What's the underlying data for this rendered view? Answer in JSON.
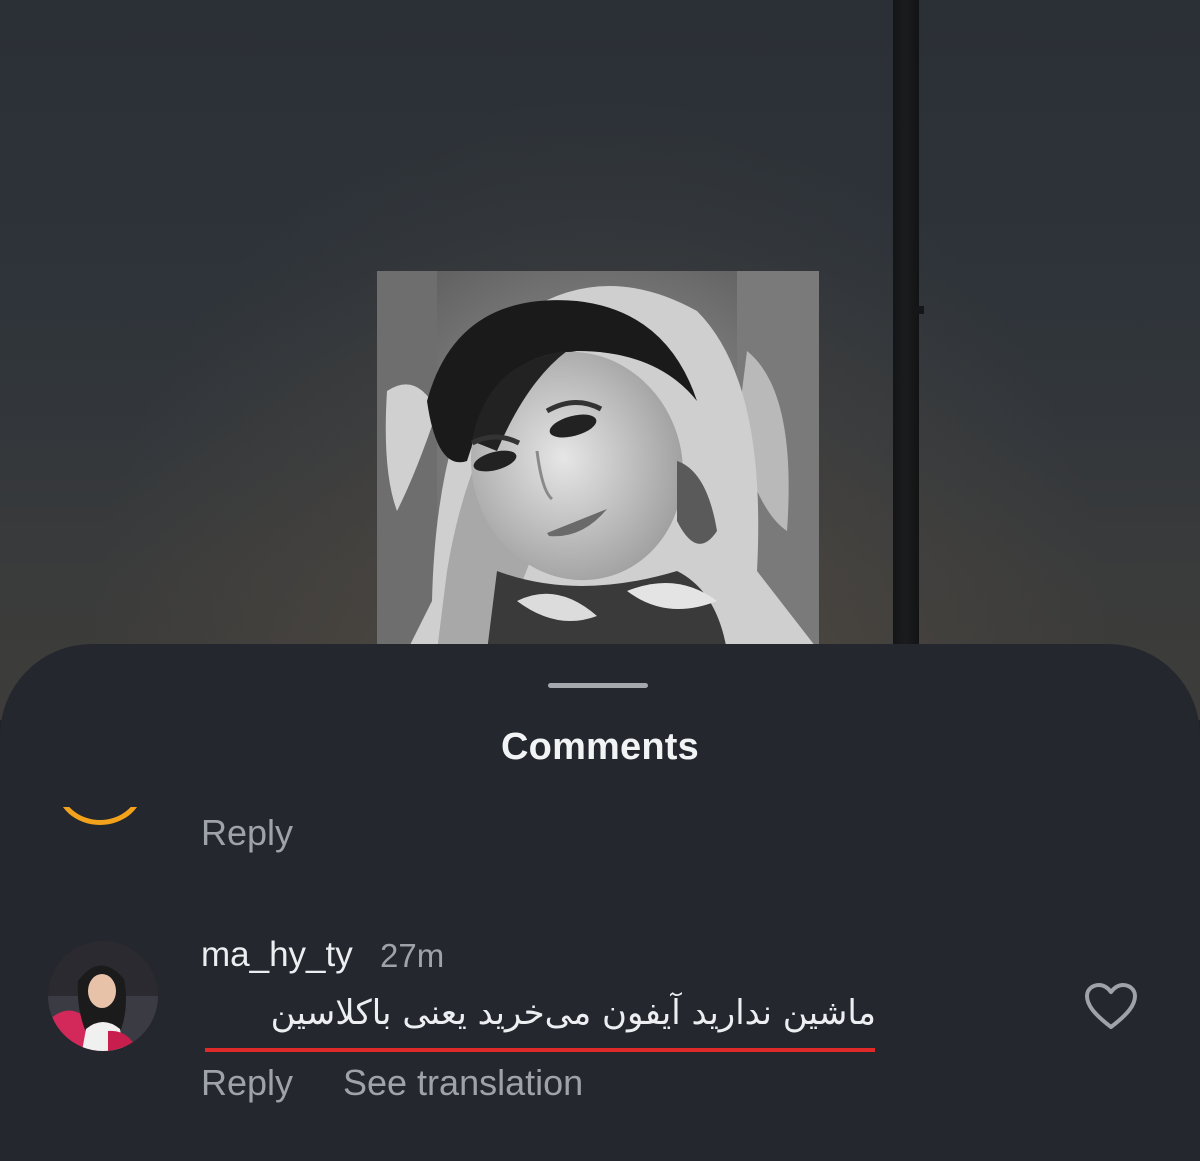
{
  "sheet": {
    "title": "Comments"
  },
  "previous_comment": {
    "reply_label": "Reply"
  },
  "comment": {
    "username": "ma_hy_ty",
    "timestamp": "27m",
    "text": "ماشین ندارید آیفون می‌خرید یعنی باکلاسین",
    "reply_label": "Reply",
    "translate_label": "See translation",
    "underline_color": "#e02a2a",
    "like_icon": "heart-outline-icon"
  },
  "colors": {
    "sheet_background": "#24272d",
    "primary_text": "#eceef1",
    "secondary_text": "#9ea2a9",
    "story_ring": "#f2a21b"
  }
}
